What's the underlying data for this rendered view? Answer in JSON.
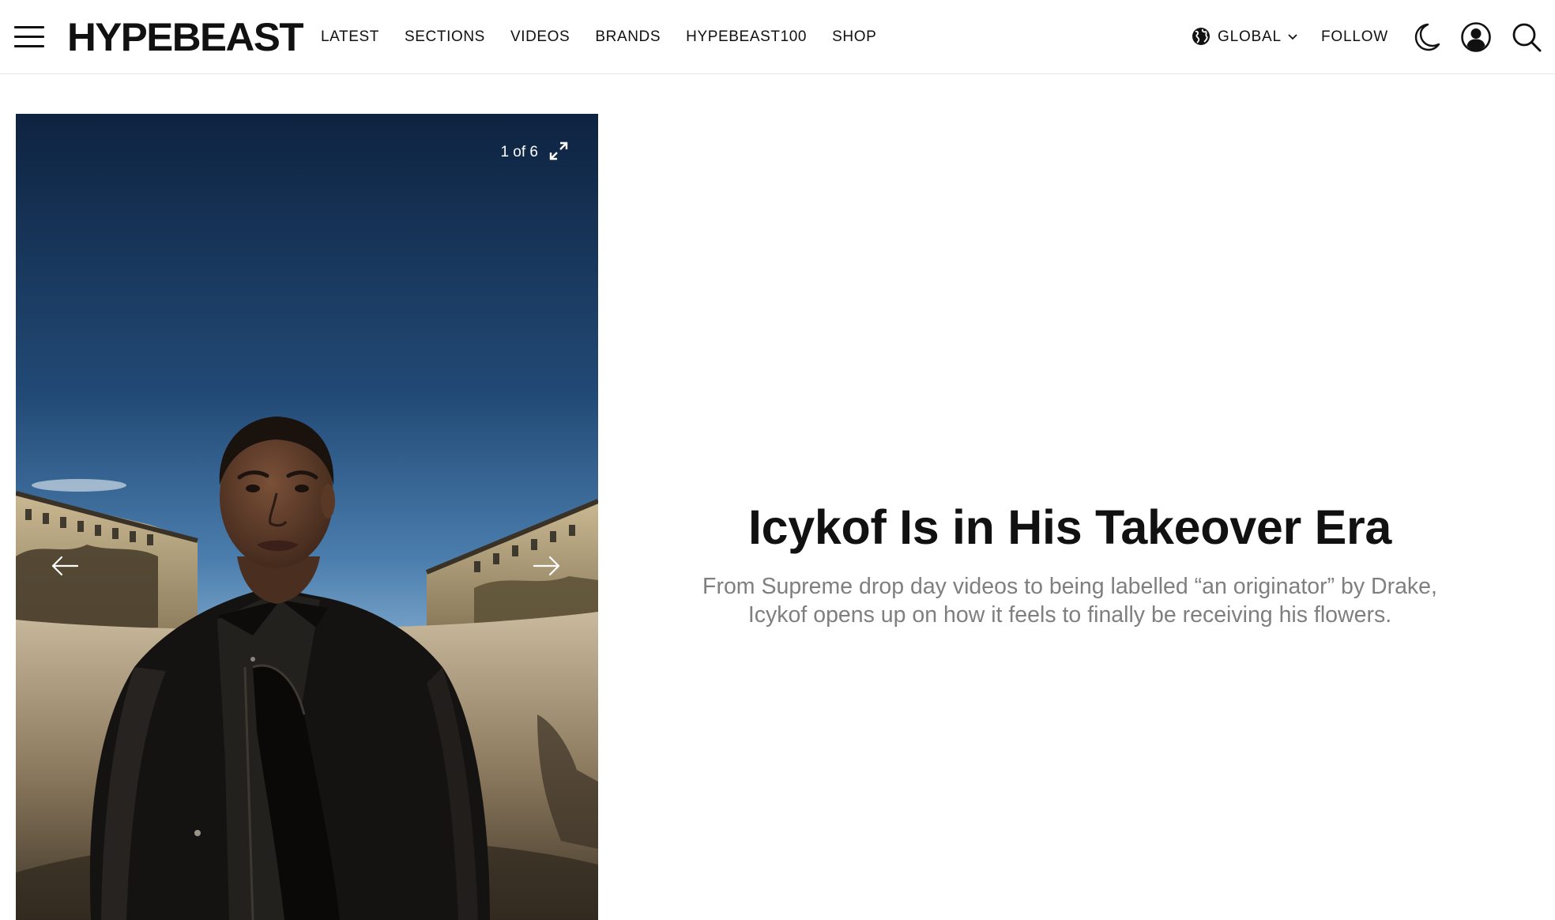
{
  "header": {
    "logo": "HYPEBEAST",
    "nav": [
      {
        "label": "LATEST"
      },
      {
        "label": "SECTIONS"
      },
      {
        "label": "VIDEOS"
      },
      {
        "label": "BRANDS"
      },
      {
        "label": "HYPEBEAST100"
      },
      {
        "label": "SHOP"
      }
    ],
    "region_label": "GLOBAL",
    "follow_label": "FOLLOW",
    "icons": {
      "menu": "hamburger-icon",
      "region": "globe-icon",
      "region_dropdown": "chevron-down-icon",
      "theme": "moon-icon",
      "account": "user-icon",
      "search": "search-icon"
    }
  },
  "gallery": {
    "counter": "1 of 6",
    "icons": {
      "expand": "expand-icon",
      "prev": "arrow-left-icon",
      "next": "arrow-right-icon"
    }
  },
  "article": {
    "headline": "Icykof Is in His Takeover Era",
    "dek": "From Supreme drop day videos to being labelled “an originator” by Drake, Icykof opens up on how it feels to finally be receiving his flowers."
  },
  "colors": {
    "text": "#111111",
    "dek": "#7f7f7f",
    "divider": "#e6e6e6",
    "background": "#ffffff"
  }
}
